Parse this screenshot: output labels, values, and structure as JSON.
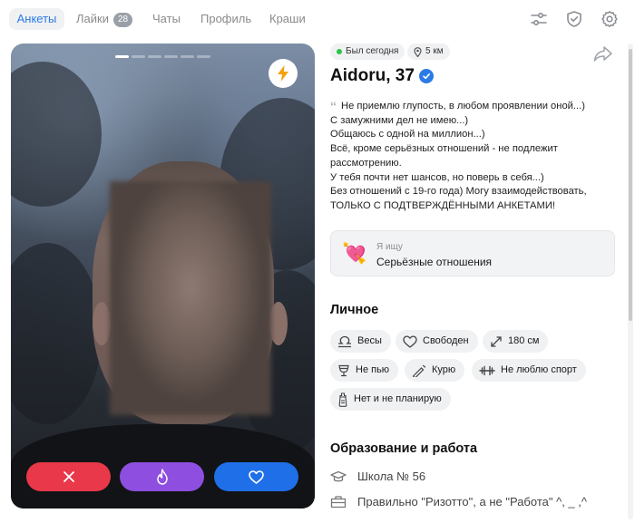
{
  "nav": {
    "tabs": [
      {
        "label": "Анкеты"
      },
      {
        "label": "Лайки",
        "badge": "28"
      },
      {
        "label": "Чаты"
      },
      {
        "label": "Профиль"
      },
      {
        "label": "Краши"
      }
    ],
    "icons": [
      "filters-icon",
      "shield-icon",
      "settings-icon"
    ]
  },
  "photo": {
    "pages_total": 6,
    "current_page": 1,
    "boost_icon": "lightning-icon"
  },
  "actions": {
    "dislike_icon": "close-icon",
    "superlike_icon": "flame-icon",
    "like_icon": "heart-icon",
    "colors": {
      "dislike": "#e8384a",
      "superlike": "#8e4fe0",
      "like": "#1f6fe8"
    }
  },
  "profile": {
    "status": "Был сегодня",
    "distance": "5 км",
    "name": "Aidoru, 37",
    "verified": true,
    "bio_lines": [
      "Не приемлю глупость, в любом проявлении оной...)",
      "С замужними дел не имею...)",
      "Общаюсь с одной на миллион...)",
      "Всё, кроме серьёзных отношений - не подлежит",
      "рассмотрению.",
      "У тебя почти нет шансов, но поверь в себя...)",
      "Без отношений с 19-го года) Могу взаимодействовать,",
      "ТОЛЬКО С ПОДТВЕРЖДЁННЫМИ АНКЕТАМИ!"
    ],
    "seeking": {
      "label": "Я ищу",
      "value": "Серьёзные отношения"
    }
  },
  "personal": {
    "title": "Личное",
    "tags": [
      {
        "icon": "libra-icon",
        "text": "Весы"
      },
      {
        "icon": "heart-outline-icon",
        "text": "Свободен"
      },
      {
        "icon": "height-icon",
        "text": "180 см"
      },
      {
        "icon": "glass-icon",
        "text": "Не пью"
      },
      {
        "icon": "cigarette-icon",
        "text": "Курю"
      },
      {
        "icon": "dumbbell-icon",
        "text": "Не люблю спорт"
      },
      {
        "icon": "baby-bottle-icon",
        "text": "Нет и не планирую"
      }
    ]
  },
  "education": {
    "title": "Образование и работа",
    "items": [
      {
        "icon": "graduation-cap-icon",
        "text": "Школа № 56"
      },
      {
        "icon": "briefcase-icon",
        "text": "Правильно \"Ризотто\", а не \"Работа\" ^, _ ,^"
      }
    ]
  }
}
